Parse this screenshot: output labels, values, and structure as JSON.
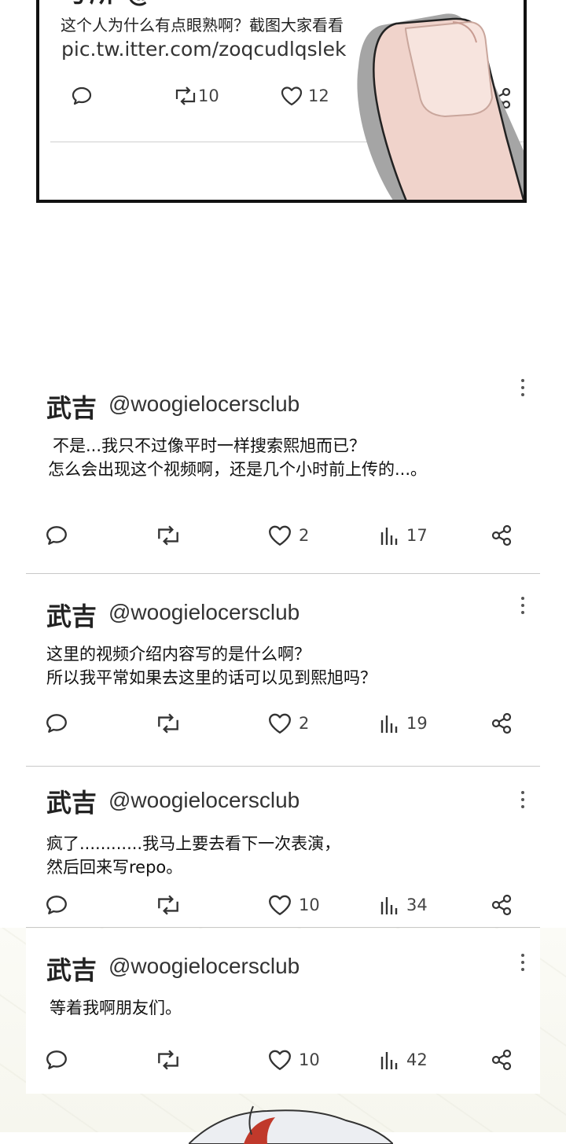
{
  "top_panel": {
    "partial_header": "号所 @",
    "text_line1": "这个人为什么有点眼熟啊？截图大家看看",
    "text_line2": "pic.tw.itter.com/zoqcudlqslek",
    "retweets": "10",
    "likes": "12"
  },
  "tweets": [
    {
      "name": "武吉",
      "handle": "@woogielocersclub",
      "lines": [
        "不是...我只不过像平时一样搜索熙旭而已？",
        "怎么会出现这个视频啊，还是几个小时前上传的...。"
      ],
      "likes": "2",
      "views": "17"
    },
    {
      "name": "武吉",
      "handle": "@woogielocersclub",
      "lines": [
        "这里的视频介绍内容写的是什么啊？",
        "所以我平常如果去这里的话可以见到熙旭吗？"
      ],
      "likes": "2",
      "views": "19"
    },
    {
      "name": "武吉",
      "handle": "@woogielocersclub",
      "lines": [
        "疯了............我马上要去看下一次表演，",
        "然后回来写repo。"
      ],
      "likes": "10",
      "views": "34"
    },
    {
      "name": "武吉",
      "handle": "@woogielocersclub",
      "lines": [
        "等着我啊朋友们。"
      ],
      "likes": "10",
      "views": "42"
    }
  ],
  "icons": [
    "reply-icon",
    "retweet-icon",
    "like-icon",
    "views-icon",
    "share-icon",
    "more-icon"
  ]
}
